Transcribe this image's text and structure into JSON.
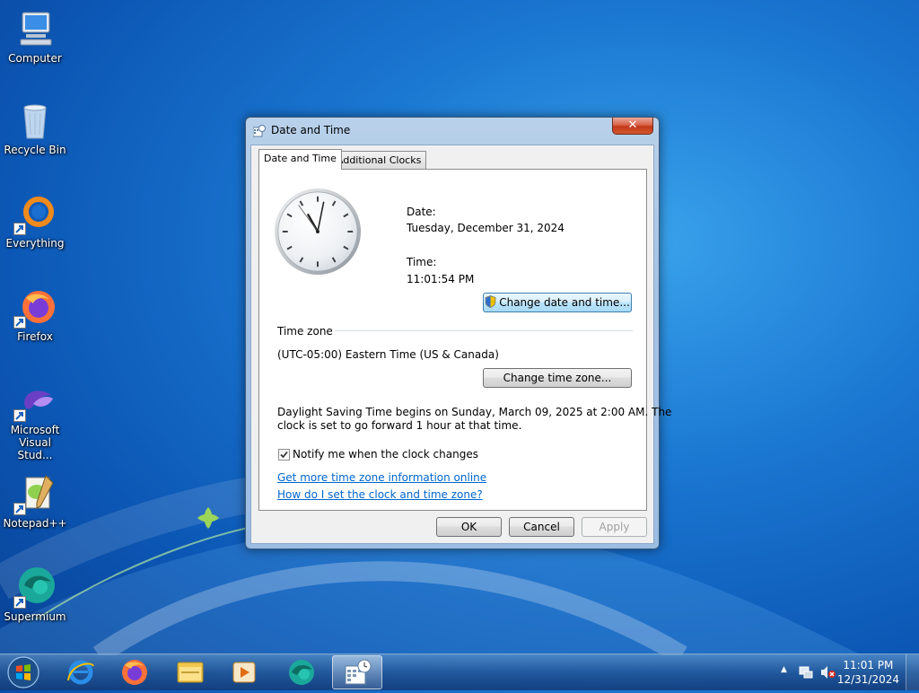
{
  "desktop": {
    "icons": [
      {
        "label": "Computer"
      },
      {
        "label": "Recycle Bin"
      },
      {
        "label": "Everything"
      },
      {
        "label": "Firefox"
      },
      {
        "label": "Microsoft Visual Stud..."
      },
      {
        "label": "Notepad++"
      },
      {
        "label": "Supermium"
      }
    ]
  },
  "window": {
    "title": "Date and Time",
    "close_label": "✕",
    "tabs": [
      {
        "label": "Date and Time",
        "selected": true
      },
      {
        "label": "Additional Clocks",
        "selected": false
      }
    ],
    "date_label": "Date:",
    "date_value": "Tuesday, December 31, 2024",
    "time_label": "Time:",
    "time_value": "11:01:54 PM",
    "change_datetime_button": "Change date and time...",
    "timezone_heading": "Time zone",
    "timezone_value": "(UTC-05:00) Eastern Time (US & Canada)",
    "change_timezone_button": "Change time zone...",
    "dst_line1": "Daylight Saving Time begins on Sunday, March 09, 2025 at 2:00 AM. The",
    "dst_line2": "clock is set to go forward 1 hour at that time.",
    "notify_label": "Notify me when the clock changes",
    "notify_checked": true,
    "link1": "Get more time zone information online",
    "link2": "How do I set the clock and time zone?",
    "ok_button": "OK",
    "cancel_button": "Cancel",
    "apply_button": "Apply",
    "clock": {
      "hours": 11,
      "minutes": 1,
      "seconds": 54
    }
  },
  "taskbar": {
    "items": [
      "start-orb",
      "internet-explorer",
      "firefox",
      "file-explorer",
      "media-player",
      "supermium",
      "date-and-time"
    ],
    "time": "11:01 PM",
    "date": "12/31/2024"
  }
}
